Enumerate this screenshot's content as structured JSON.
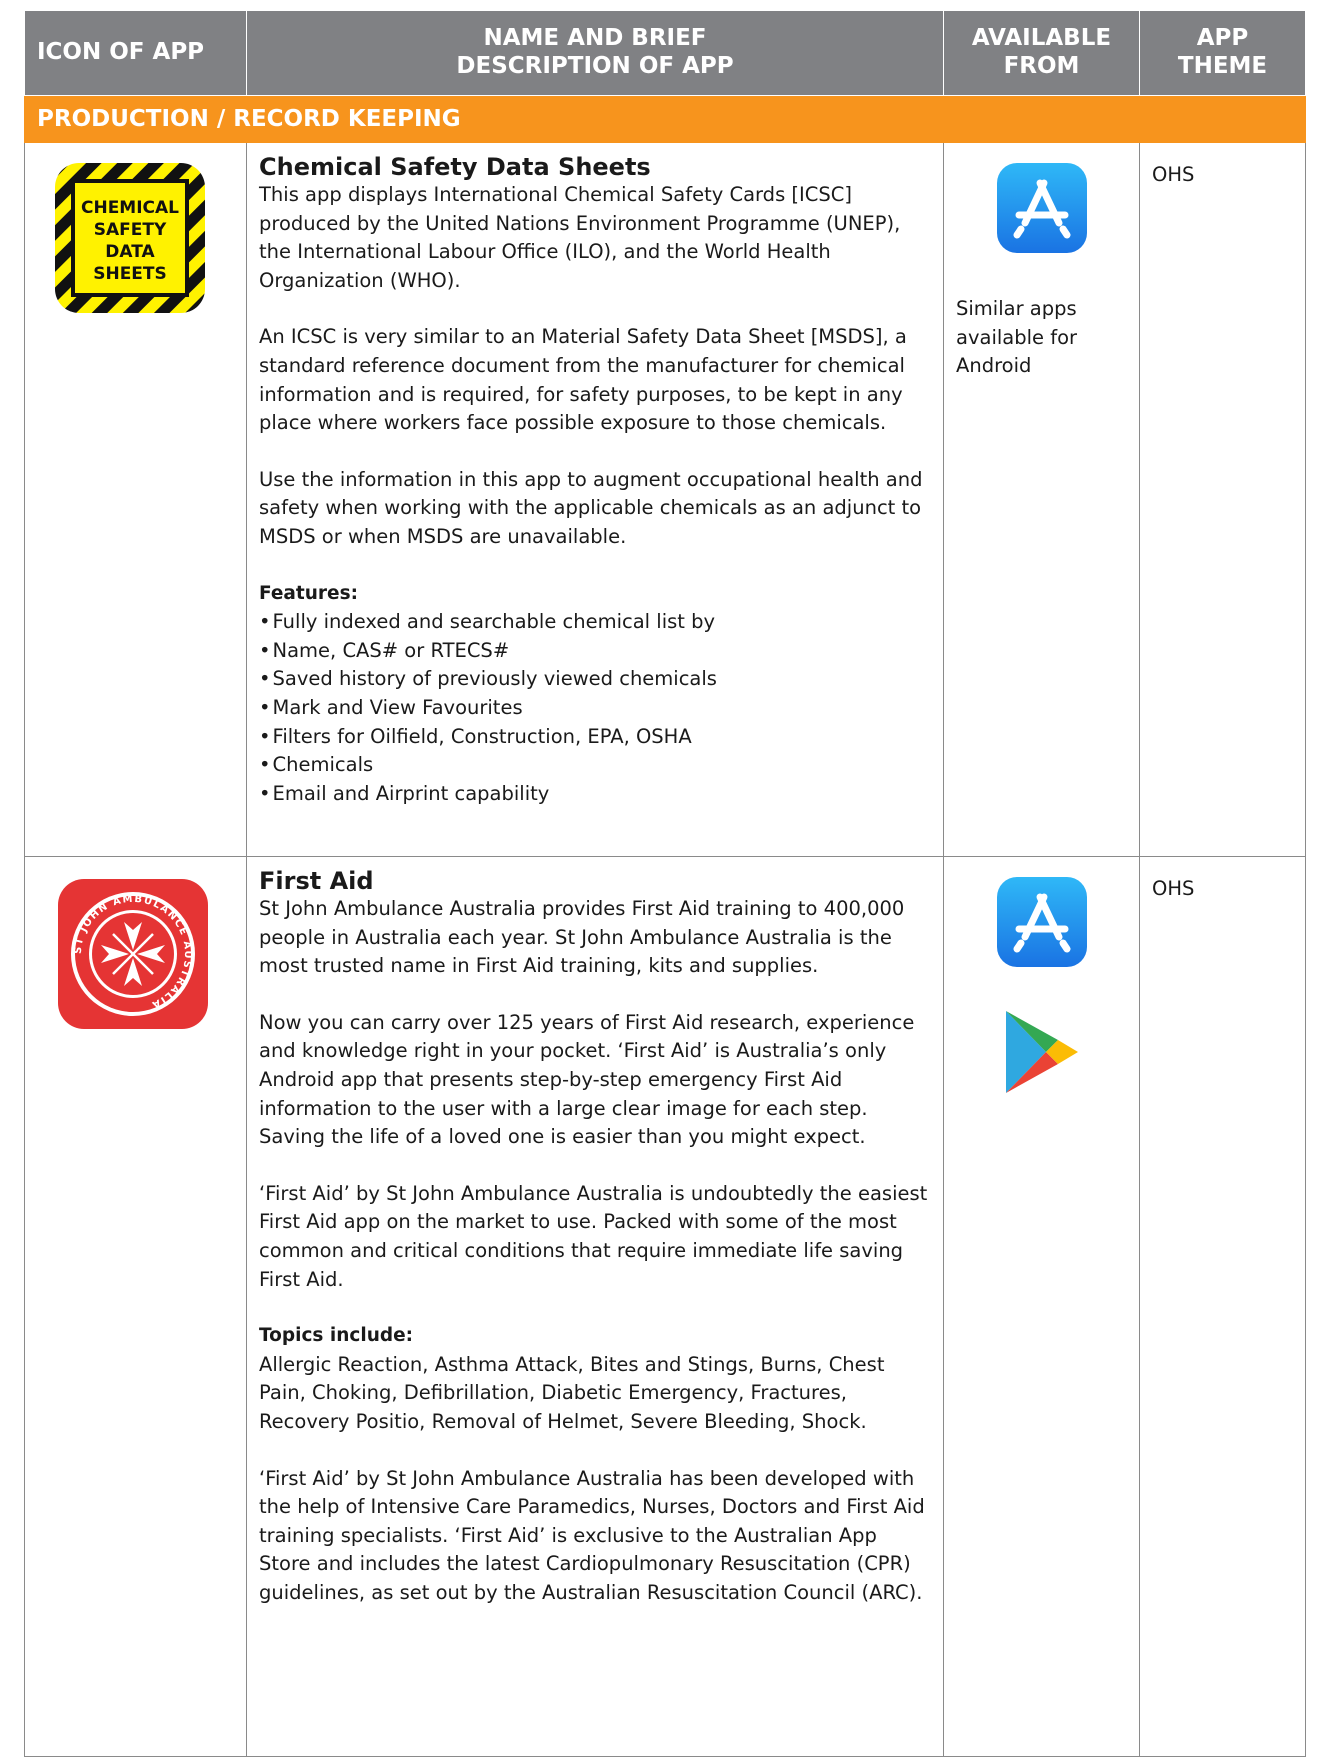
{
  "header": {
    "col_icon": "ICON OF APP",
    "col_name_line1": "NAME AND BRIEF",
    "col_name_line2": "DESCRIPTION OF APP",
    "col_avail_line1": "AVAILABLE",
    "col_avail_line2": "FROM",
    "col_theme_line1": "APP",
    "col_theme_line2": "THEME"
  },
  "section": {
    "label": "PRODUCTION / RECORD KEEPING"
  },
  "apps": [
    {
      "icon_name": "chemical-safety-data-sheets-icon",
      "icon_text": [
        "CHEMICAL",
        "SAFETY",
        "DATA",
        "SHEETS"
      ],
      "title": "Chemical Safety Data Sheets",
      "paragraphs": [
        "This app displays International Chemical Safety Cards [ICSC] produced by the United Nations Environment Programme (UNEP), the International Labour Office (ILO), and the World Health Organization (WHO).",
        "An ICSC is very similar to an Material Safety Data Sheet [MSDS], a standard reference document from the manufacturer for chemical information and is required, for safety purposes, to be kept in any place where workers face possible exposure to those chemicals.",
        "Use the information in this app to augment occupational health and safety when working with the applicable chemicals as an adjunct to MSDS or when MSDS are unavailable."
      ],
      "features_label": "Features:",
      "features": [
        "Fully indexed and searchable chemical list by",
        "Name, CAS# or RTECS#",
        "Saved history of previously viewed chemicals",
        "Mark and View Favourites",
        "Filters for Oilfield, Construction, EPA, OSHA",
        "Chemicals",
        "Email and Airprint capability"
      ],
      "available_note": "Similar apps available for Android",
      "theme": "OHS"
    },
    {
      "icon_name": "st-john-ambulance-icon",
      "icon_text": "ST JOHN AMBULANCE AUSTRALIA",
      "title": "First Aid",
      "paragraphs": [
        "St John Ambulance Australia provides First Aid training to 400,000 people in Australia each year. St John Ambulance Australia is the most trusted name in First Aid training, kits and supplies.",
        "Now you can carry over 125 years of First Aid research, experience and knowledge right in your pocket. ‘First Aid’ is Australia’s only Android app that presents step-by-step emergency First Aid information to the user with a large clear image for each step. Saving the life of a loved one is easier than you might expect.",
        "‘First Aid’ by St John Ambulance Australia is undoubtedly the easiest First Aid app on the market to use. Packed with some of the most common and critical conditions that require immediate life saving First Aid."
      ],
      "topics_label": "Topics include:",
      "topics": "Allergic Reaction, Asthma Attack, Bites and Stings, Burns, Chest Pain, Choking, Defibrillation, Diabetic Emergency, Fractures, Recovery Positio, Removal of Helmet, Severe Bleeding, Shock.",
      "closing": "‘First Aid’ by St John Ambulance Australia has been developed with the help of Intensive Care Paramedics, Nurses, Doctors and First Aid training specialists. ‘First Aid’ is exclusive to the Australian App Store and includes the latest Cardiopulmonary Resuscitation (CPR) guidelines, as set out by the Australian Resuscitation Council (ARC).",
      "theme": "OHS"
    }
  ],
  "colors": {
    "header_bg": "#808184",
    "section_bg": "#f7941d",
    "app_store_blue": "#1a73e3",
    "st_john_red": "#e53434",
    "chem_yellow": "#fff200"
  }
}
